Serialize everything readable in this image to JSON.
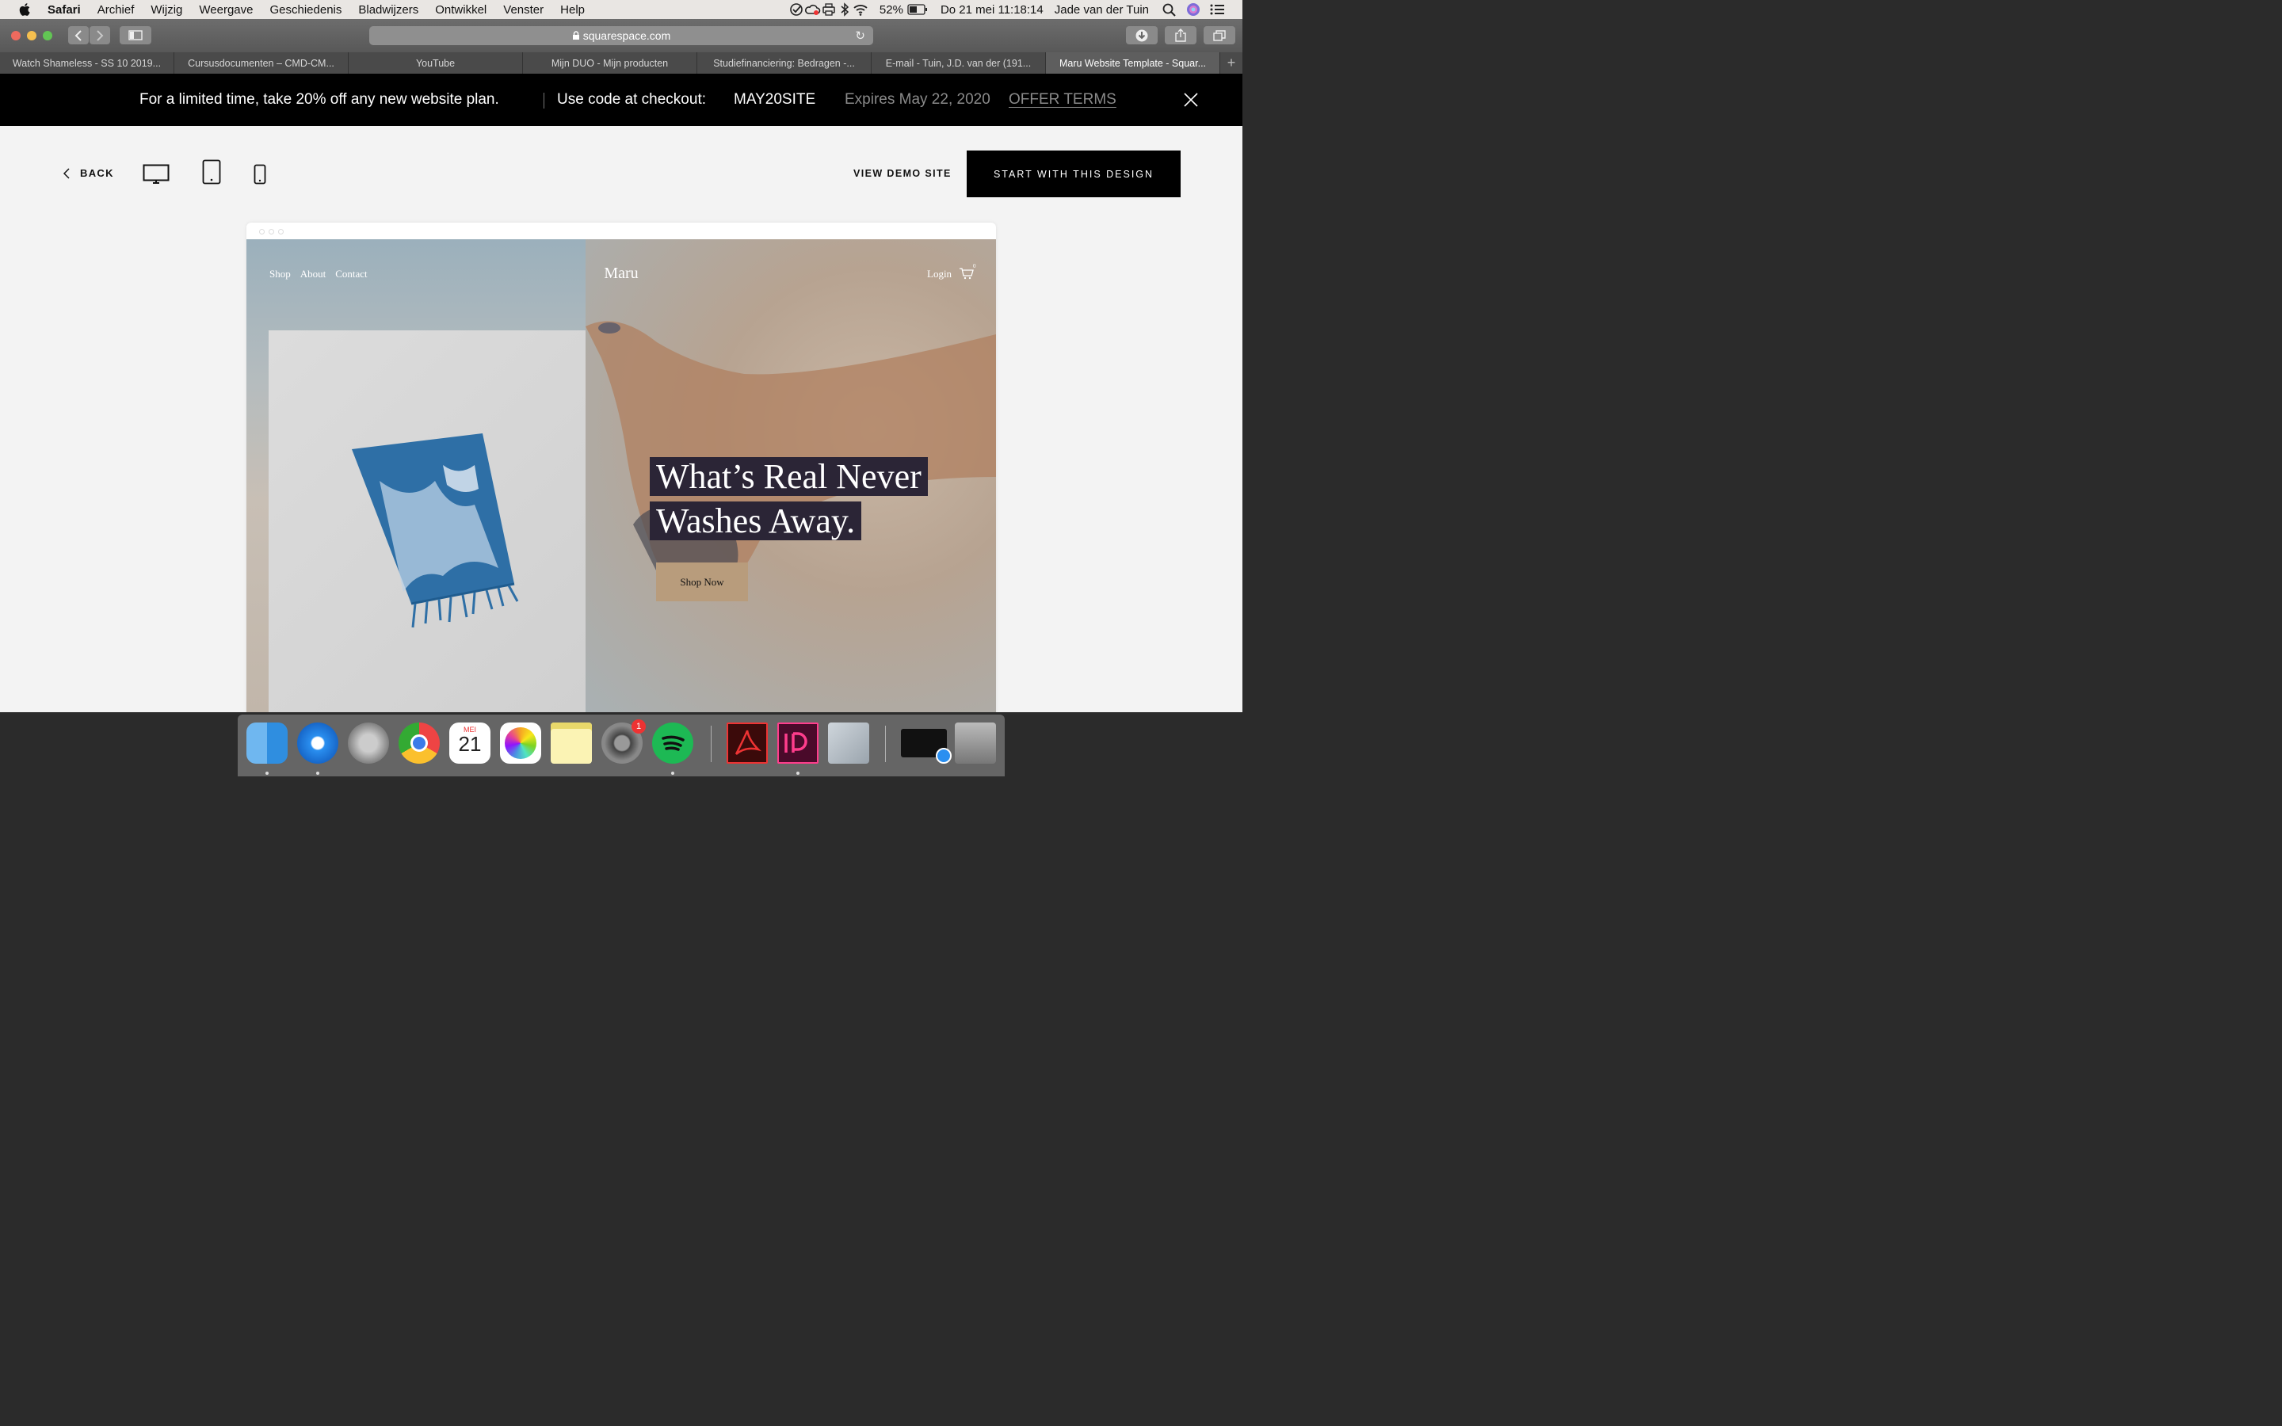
{
  "menubar": {
    "app": "Safari",
    "items": [
      "Archief",
      "Wijzig",
      "Weergave",
      "Geschiedenis",
      "Bladwijzers",
      "Ontwikkel",
      "Venster",
      "Help"
    ],
    "battery": "52%",
    "datetime": "Do 21 mei  11:18:14",
    "user": "Jade van der Tuin"
  },
  "browser": {
    "url": "squarespace.com",
    "tabs": [
      "Watch Shameless - SS 10 2019...",
      "Cursusdocumenten – CMD-CM...",
      "YouTube",
      "Mijn DUO - Mijn producten",
      "Studiefinanciering: Bedragen -...",
      "E-mail - Tuin, J.D. van der (191...",
      "Maru Website Template - Squar..."
    ],
    "tab_add": "+"
  },
  "promo": {
    "offer": "For a limited time, take 20% off any new website plan.",
    "code_label": "Use code at checkout:",
    "code": "MAY20SITE",
    "expires": "Expires May 22, 2020",
    "terms": "OFFER TERMS"
  },
  "preview": {
    "back": "BACK",
    "view_demo": "VIEW DEMO SITE",
    "start": "START WITH THIS DESIGN"
  },
  "site": {
    "nav": [
      "Shop",
      "About",
      "Contact"
    ],
    "brand": "Maru",
    "login": "Login",
    "cart_count": "0",
    "headline_line1": "What’s Real Never",
    "headline_line2": "Washes Away.",
    "cta": "Shop Now"
  },
  "dock": {
    "calendar_month": "MEI",
    "calendar_day": "21",
    "settings_badge": "1"
  },
  "colors": {
    "promo_bg": "#000000",
    "headline_bg": "#2b2536",
    "cta_bg": "#b89c7c",
    "page_bg": "#f3f3f3"
  }
}
